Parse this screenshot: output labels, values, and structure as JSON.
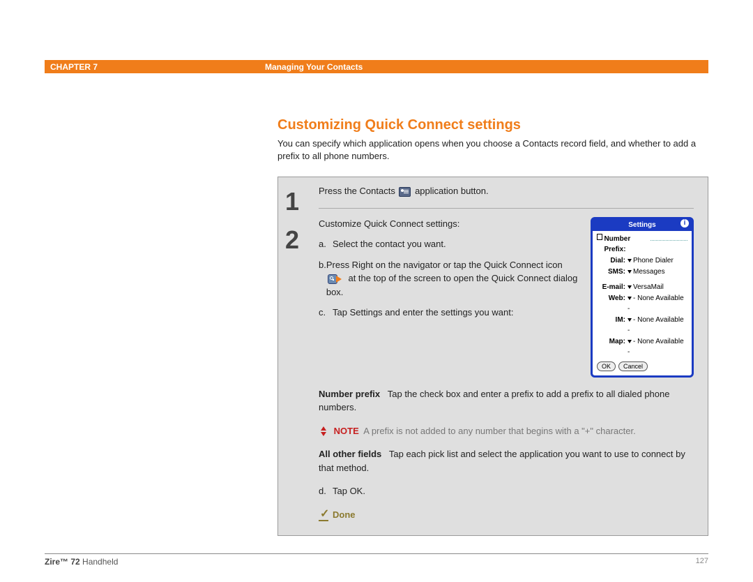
{
  "header": {
    "chapter": "CHAPTER 7",
    "section": "Managing Your Contacts"
  },
  "section_title": "Customizing Quick Connect settings",
  "intro": "You can specify which application opens when you choose a Contacts record field, and whether to add a prefix to all phone numbers.",
  "steps": {
    "num1": "1",
    "num2": "2",
    "s1_a": "Press the Contacts ",
    "s1_b": " application button.",
    "s2_lead": "Customize Quick Connect settings:",
    "s2_a": "Select the contact you want.",
    "s2_b_1": "Press Right on the navigator or tap the Quick Connect icon ",
    "s2_b_2": " at the top of the screen to open the Quick Connect dialog box.",
    "s2_c": "Tap Settings and enter the settings you want:",
    "np_label": "Number prefix",
    "np_text": "Tap the check box and enter a prefix to add a prefix to all dialed phone numbers.",
    "note_label": "NOTE",
    "note_text": "A prefix is not added to any number that begins with a \"+\" character.",
    "aof_label": "All other fields",
    "aof_text": "Tap each pick list and select the application you want to use to connect by that method.",
    "s2_d": "Tap OK.",
    "done": "Done"
  },
  "settings_panel": {
    "title": "Settings",
    "np": "Number Prefix:",
    "dial_l": "Dial:",
    "dial_v": "Phone Dialer",
    "sms_l": "SMS:",
    "sms_v": "Messages",
    "email_l": "E-mail:",
    "email_v": "VersaMail",
    "web_l": "Web:",
    "web_v": "- None Available -",
    "im_l": "IM:",
    "im_v": "- None Available -",
    "map_l": "Map:",
    "map_v": "- None Available -",
    "ok": "OK",
    "cancel": "Cancel"
  },
  "footer": {
    "device_bold": "Zire™ 72",
    "device_rest": " Handheld",
    "page": "127"
  }
}
